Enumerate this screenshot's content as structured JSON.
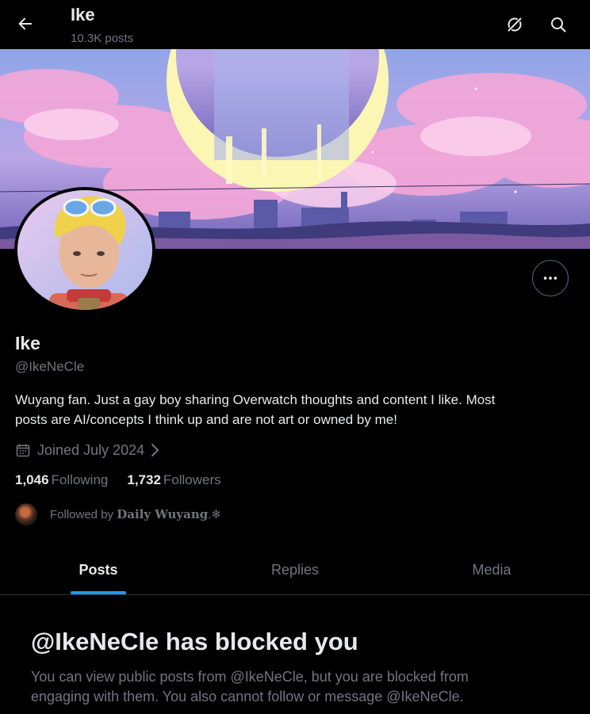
{
  "header": {
    "name": "Ike",
    "posts_count": "10.3K posts",
    "back_icon": "arrow-left-icon",
    "grok_icon": "grok-slash-icon",
    "search_icon": "search-icon"
  },
  "profile": {
    "name": "Ike",
    "handle": "@IkeNeCle",
    "bio_lines": [
      "Wuyang fan. Just a gay boy sharing Overwatch thoughts and content I like. Most",
      "posts are AI/concepts I think up and are not art or owned by me!"
    ],
    "joined": "Joined July 2024",
    "following_count": "1,046",
    "following_label": "Following",
    "followers_count": "1,732",
    "followers_label": "Followers",
    "followed_by_prefix": "Followed by",
    "followed_by_name": "Daily Wuyang",
    "followed_by_suffix": ".❄"
  },
  "tabs": [
    {
      "label": "Posts",
      "active": true
    },
    {
      "label": "Replies",
      "active": false
    },
    {
      "label": "Media",
      "active": false
    }
  ],
  "blocked": {
    "title": "@IkeNeCle has blocked you",
    "line1": "You can view public posts from @IkeNeCle, but you are blocked from",
    "line2": "engaging with them. You also cannot follow or message @IkeNeCle."
  },
  "colors": {
    "background": "#000000",
    "accent": "#1d9bf0",
    "text_primary": "#e7e9ea",
    "text_secondary": "#71767b"
  }
}
